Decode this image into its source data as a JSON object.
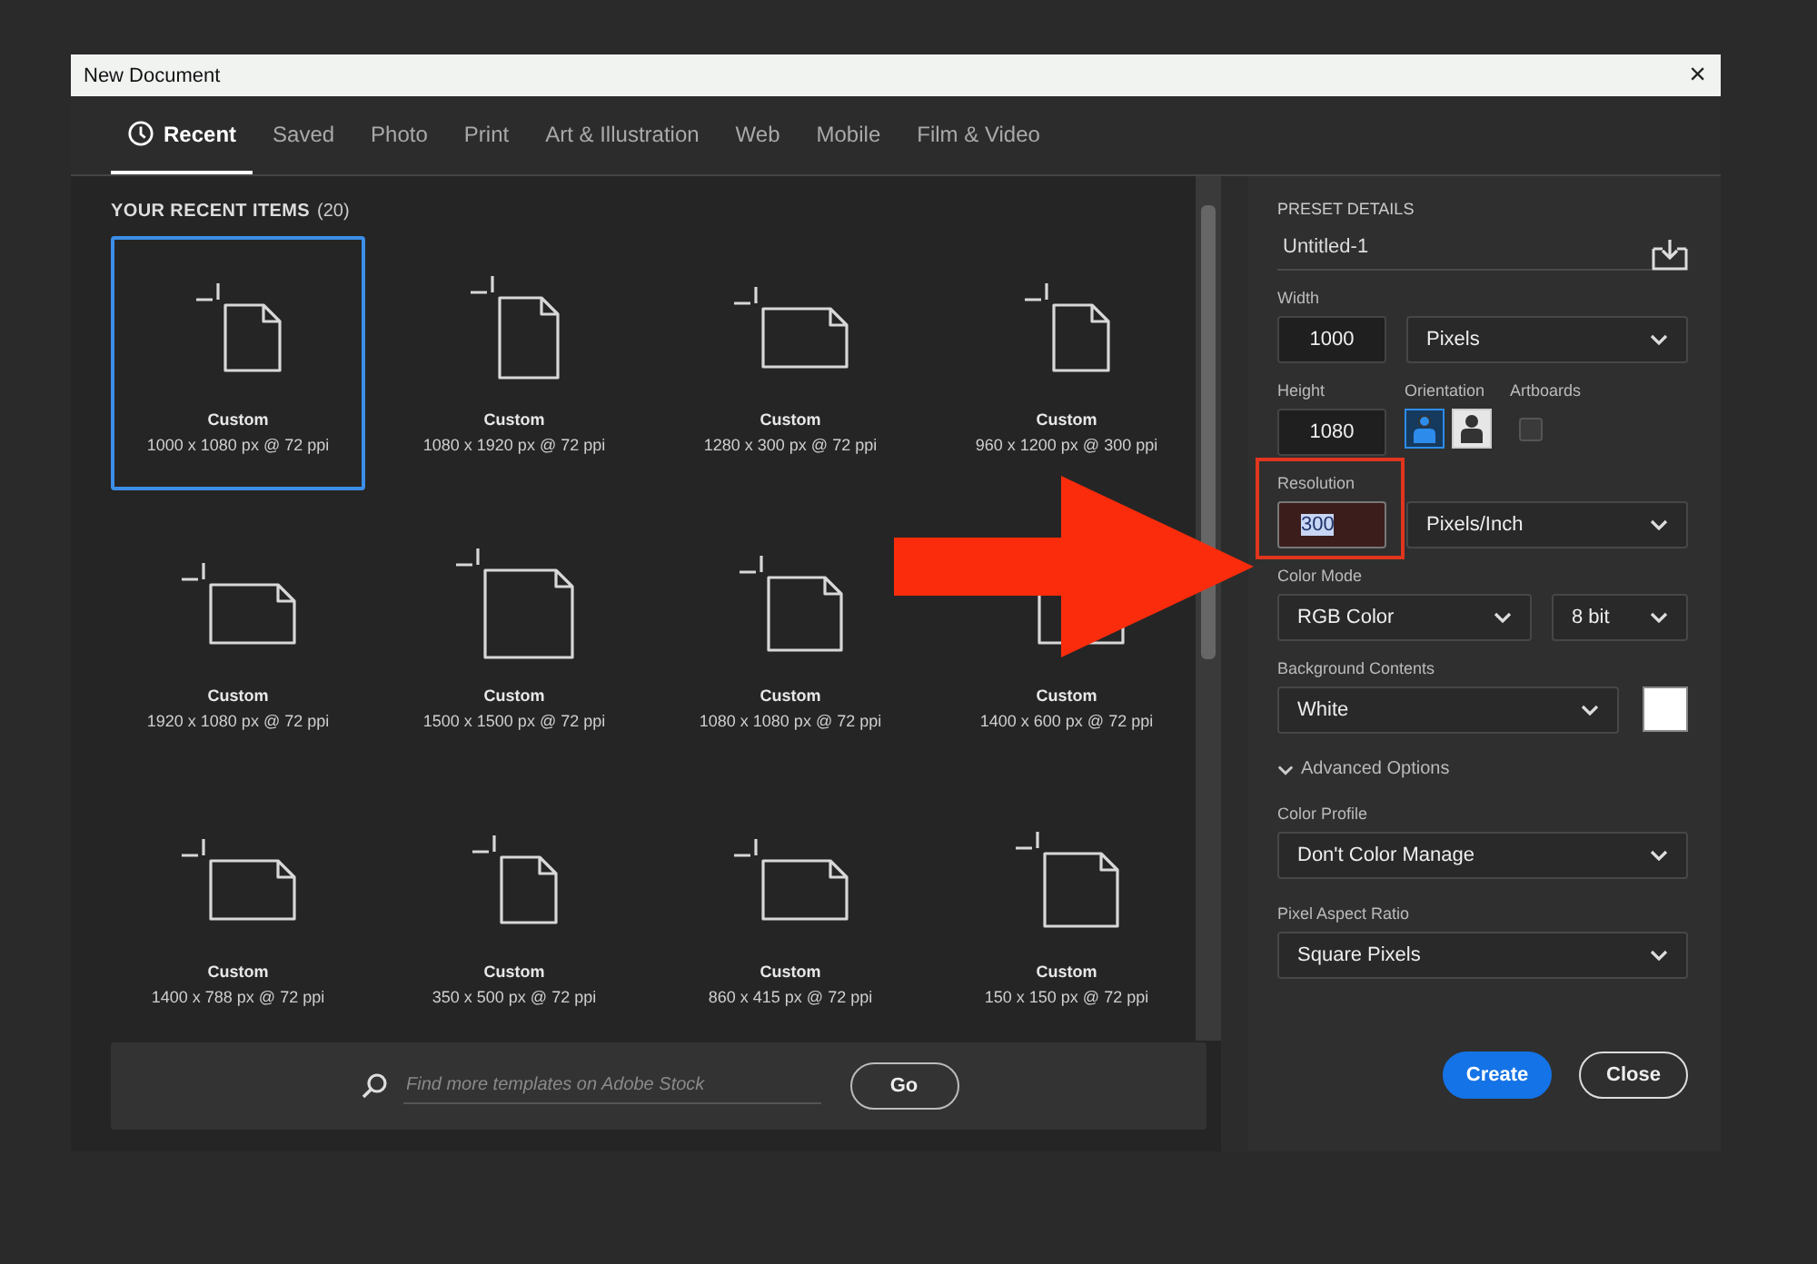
{
  "window": {
    "title": "New Document",
    "close": "×"
  },
  "tabs": [
    {
      "label": "Recent",
      "selected": true,
      "icon": true
    },
    {
      "label": "Saved",
      "selected": false
    },
    {
      "label": "Photo",
      "selected": false
    },
    {
      "label": "Print",
      "selected": false
    },
    {
      "label": "Art & Illustration",
      "selected": false
    },
    {
      "label": "Web",
      "selected": false
    },
    {
      "label": "Mobile",
      "selected": false
    },
    {
      "label": "Film & Video",
      "selected": false
    }
  ],
  "recent": {
    "heading": "YOUR RECENT ITEMS",
    "count": "(20)",
    "items": [
      {
        "name": "Custom",
        "size": "1000 x 1080 px @ 72 ppi",
        "kind": "portrait",
        "selected": true
      },
      {
        "name": "Custom",
        "size": "1080 x 1920 px @ 72 ppi",
        "kind": "tall",
        "selected": false
      },
      {
        "name": "Custom",
        "size": "1280 x 300 px @ 72 ppi",
        "kind": "landscape",
        "selected": false
      },
      {
        "name": "Custom",
        "size": "960 x 1200 px @ 300 ppi",
        "kind": "portrait",
        "selected": false
      },
      {
        "name": "Custom",
        "size": "1920 x 1080 px @ 72 ppi",
        "kind": "landscape",
        "selected": false
      },
      {
        "name": "Custom",
        "size": "1500 x 1500 px @ 72 ppi",
        "kind": "large",
        "selected": false
      },
      {
        "name": "Custom",
        "size": "1080 x 1080 px @ 72 ppi",
        "kind": "square",
        "selected": false
      },
      {
        "name": "Custom",
        "size": "1400 x 600 px @ 72 ppi",
        "kind": "landscape",
        "selected": false
      },
      {
        "name": "Custom",
        "size": "1400 x 788 px @ 72 ppi",
        "kind": "landscape",
        "selected": false
      },
      {
        "name": "Custom",
        "size": "350 x 500 px @ 72 ppi",
        "kind": "portrait",
        "selected": false
      },
      {
        "name": "Custom",
        "size": "860 x 415 px @ 72 ppi",
        "kind": "landscape",
        "selected": false
      },
      {
        "name": "Custom",
        "size": "150 x 150 px @ 72 ppi",
        "kind": "square",
        "selected": false
      }
    ]
  },
  "search": {
    "placeholder": "Find more templates on Adobe Stock",
    "button": "Go"
  },
  "details": {
    "heading": "PRESET DETAILS",
    "name": "Untitled-1",
    "width": {
      "label": "Width",
      "value": "1000",
      "unit": "Pixels"
    },
    "height": {
      "label": "Height",
      "value": "1080"
    },
    "orientation": {
      "label": "Orientation",
      "options": [
        {
          "selected": true
        },
        {
          "selected": false
        }
      ]
    },
    "artboards": {
      "label": "Artboards",
      "checked": false
    },
    "resolution": {
      "label": "Resolution",
      "value": "300",
      "selected": true,
      "unit": "Pixels/Inch"
    },
    "color_mode": {
      "label": "Color Mode",
      "value": "RGB Color",
      "depth": "8 bit"
    },
    "background": {
      "label": "Background Contents",
      "value": "White",
      "color": "#ffffff"
    },
    "advanced": {
      "label": "Advanced Options",
      "expanded": true
    },
    "color_profile": {
      "label": "Color Profile",
      "value": "Don't Color Manage"
    },
    "pixel_aspect": {
      "label": "Pixel Aspect Ratio",
      "value": "Square Pixels"
    }
  },
  "buttons": [
    {
      "label": "Create",
      "kind": "primary"
    },
    {
      "label": "Close",
      "kind": "secondary"
    }
  ]
}
